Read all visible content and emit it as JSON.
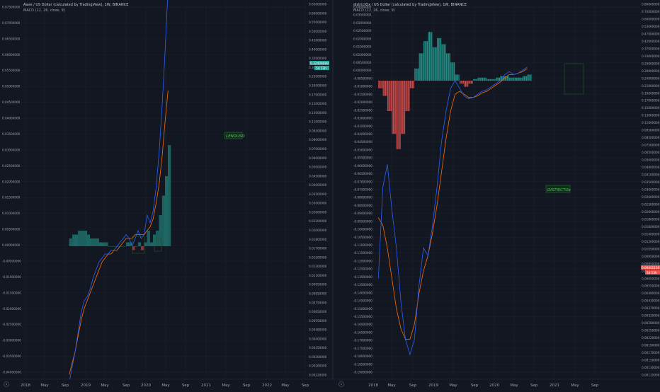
{
  "theme": {
    "bg": "#131722",
    "grid": "#1e222d",
    "macd": "#2962ff",
    "signal": "#ff6d00",
    "hist_pos": "#26a69a",
    "hist_neg": "#ef5350",
    "box": "#1b5e20"
  },
  "left_panel": {
    "header": "Aave / US Dollar (calculated by TradingView), 1W, BINANCE",
    "subheader": "MACD (12, 26, close, 9)",
    "annotation": "LENDUSD",
    "price_badge": "0.32409099",
    "price_badge2": "5d 13h"
  },
  "right_panel": {
    "header": "districtOx / US Dollar (calculated by TradingView), 1W, BINANCE",
    "subheader": "MACD (12, 26, close, 9)",
    "annotation": "DISTRICTOx",
    "price_badge": "0.08451150",
    "price_badge2": "5d 13h"
  },
  "chart_data": [
    {
      "type": "line",
      "title": "Aave / US Dollar (calculated by TradingView), 1W, BINANCE",
      "indicator": "MACD (12, 26, close, 9)",
      "x_ticks": [
        "2018",
        "May",
        "Sep",
        "2019",
        "May",
        "Sep",
        "2020",
        "May",
        "Sep",
        "2021",
        "May",
        "Sep",
        "2022",
        "May",
        "Sep"
      ],
      "macd_axis_ticks": [
        "0.07500000",
        "0.07000000",
        "0.06500000",
        "0.06000000",
        "0.05500000",
        "0.05000000",
        "0.04500000",
        "0.04000000",
        "0.03500000",
        "0.03000000",
        "0.02500000",
        "0.02000000",
        "0.01500000",
        "0.01000000",
        "0.00500000",
        "0.00000000",
        "-0.00500000",
        "-0.01000000",
        "-0.01500000",
        "-0.02000000",
        "-0.02500000",
        "-0.03000000",
        "-0.03500000",
        "-0.04000000"
      ],
      "macd_ylim": [
        -0.0425,
        0.0775
      ],
      "price_axis_ticks": [
        "0.65000000",
        "0.60000000",
        "0.55000000",
        "0.50000000",
        "0.45000000",
        "0.40000000",
        "0.35000000",
        "0.30000000",
        "0.25000000",
        "0.20000000",
        "0.17000000",
        "0.15000000",
        "0.13000000",
        "0.11000000",
        "0.09500000",
        "0.08000000",
        "0.07000000",
        "0.06000000",
        "0.05000000",
        "0.04500000",
        "0.04000000",
        "0.03500000",
        "0.03000000",
        "0.02600000",
        "0.02200000",
        "0.02000000",
        "0.01800000",
        "0.01700000",
        "0.01500000",
        "0.01300000",
        "0.01100000",
        "0.00950000",
        "0.00850000",
        "0.00750000",
        "0.00650000",
        "0.00550000",
        "0.00480000",
        "0.00400000",
        "0.00350000",
        "0.00300000",
        "0.00260000",
        "0.00220000"
      ],
      "x": [
        0.8,
        0.85,
        0.9,
        0.95,
        1.0,
        1.05,
        1.1,
        1.15,
        1.2,
        1.25,
        1.3,
        1.35,
        1.4,
        1.45,
        1.5,
        1.55,
        1.6,
        1.65,
        1.7,
        1.75,
        1.8,
        1.85,
        1.9,
        1.95,
        2.0,
        2.05,
        2.1,
        2.15,
        2.2,
        2.25,
        2.3,
        2.35,
        2.4,
        2.45,
        2.5,
        2.55,
        2.6
      ],
      "series": [
        {
          "name": "MACD",
          "values": [
            -0.035,
            -0.031,
            -0.027,
            -0.022,
            -0.017,
            -0.014,
            -0.013,
            -0.011,
            -0.008,
            -0.006,
            -0.004,
            -0.003,
            -0.002,
            -0.002,
            -0.001,
            -0.001,
            0.0,
            0.001,
            0.002,
            0.003,
            0.002,
            0.0,
            0.002,
            0.004,
            0.002,
            0.003,
            0.008,
            0.006,
            0.009,
            0.015,
            0.024,
            0.036,
            0.05,
            0.066
          ]
        },
        {
          "name": "Signal",
          "values": [
            -0.033,
            -0.03,
            -0.027,
            -0.023,
            -0.019,
            -0.016,
            -0.014,
            -0.012,
            -0.01,
            -0.008,
            -0.006,
            -0.004,
            -0.003,
            -0.002,
            -0.002,
            -0.001,
            -0.001,
            0.0,
            0.001,
            0.002,
            0.002,
            0.002,
            0.003,
            0.003,
            0.003,
            0.003,
            0.004,
            0.005,
            0.007,
            0.011,
            0.016,
            0.023,
            0.032,
            0.04
          ]
        },
        {
          "name": "Histogram",
          "values": [
            0.002,
            0.003,
            0.003,
            0.004,
            0.004,
            0.004,
            0.003,
            0.002,
            0.002,
            0.002,
            0.001,
            0.001,
            0.001,
            0.0,
            0.0,
            0.0,
            0.0,
            0.0,
            0.0,
            0.001,
            0.001,
            -0.001,
            0.0,
            0.001,
            -0.001,
            0.001,
            0.004,
            0.001,
            0.003,
            0.004,
            0.008,
            0.013,
            0.018,
            0.026
          ]
        }
      ]
    },
    {
      "type": "line",
      "title": "districtOx / US Dollar (calculated by TradingView), 1W, BINANCE",
      "indicator": "MACD (12, 26, close, 9)",
      "x_ticks": [
        "2018",
        "May",
        "Sep",
        "2019",
        "May",
        "Sep",
        "2020",
        "May",
        "Sep",
        "2021",
        "May",
        "Sep"
      ],
      "macd_axis_ticks": [
        "0.04000000",
        "0.03500000",
        "0.03000000",
        "0.02500000",
        "0.02000000",
        "0.01500000",
        "0.01000000",
        "0.00500000",
        "0.00000000",
        "-0.00500000",
        "-0.01000000",
        "-0.01500000",
        "-0.02000000",
        "-0.02500000",
        "-0.03000000",
        "-0.03500000",
        "-0.04000000",
        "-0.04500000",
        "-0.05000000",
        "-0.05500000",
        "-0.06000000",
        "-0.06500000",
        "-0.07000000",
        "-0.07500000",
        "-0.08000000",
        "-0.08500000",
        "-0.09000000",
        "-0.09500000",
        "-0.10000000",
        "-0.10500000",
        "-0.11000000",
        "-0.11500000",
        "-0.12000000",
        "-0.12500000",
        "-0.13000000",
        "-0.13500000",
        "-0.14000000",
        "-0.14500000",
        "-0.15000000",
        "-0.15500000",
        "-0.16000000",
        "-0.16500000",
        "-0.17000000",
        "-0.17500000",
        "-0.18000000",
        "-0.18500000",
        "-0.19000000"
      ],
      "macd_ylim": [
        -0.1925,
        0.0425
      ],
      "price_axis_ticks": [
        "0.80000000",
        "0.70000000",
        "0.60000000",
        "0.53000000",
        "0.47000000",
        "0.42000000",
        "0.37000000",
        "0.33000000",
        "0.29000000",
        "0.26000000",
        "0.24000000",
        "0.21000000",
        "0.19000000",
        "0.17000000",
        "0.15000000",
        "0.13000000",
        "0.11000000",
        "0.09500000",
        "0.08500000",
        "0.07500000",
        "0.06500000",
        "0.05600000",
        "0.04800000",
        "0.04100000",
        "0.03500000",
        "0.03000000",
        "0.02600000",
        "0.02300000",
        "0.02000000",
        "0.01800000",
        "0.01600000",
        "0.01400000",
        "0.01200000",
        "0.01050000",
        "0.00950000",
        "0.00850000",
        "0.00750000",
        "0.00650000",
        "0.00550000",
        "0.00490000",
        "0.00430000",
        "0.00370000",
        "0.00320000",
        "0.00280000",
        "0.00250000",
        "0.00220000",
        "0.00190000",
        "0.00170000",
        "0.00150000",
        "0.00130000",
        "0.00115000"
      ],
      "x": [
        0.3,
        0.35,
        0.4,
        0.45,
        0.5,
        0.55,
        0.6,
        0.65,
        0.7,
        0.75,
        0.8,
        0.85,
        0.9,
        0.95,
        1.0,
        1.05,
        1.1,
        1.15,
        1.2,
        1.25,
        1.3,
        1.35,
        1.4,
        1.45,
        1.5,
        1.55,
        1.6,
        1.65,
        1.7,
        1.75,
        1.8,
        1.85,
        1.9,
        1.95,
        2.0,
        2.05,
        2.1,
        2.15,
        2.2
      ],
      "series": [
        {
          "name": "MACD",
          "values": [
            -0.13,
            -0.07,
            -0.055,
            -0.085,
            -0.11,
            -0.145,
            -0.17,
            -0.18,
            -0.17,
            -0.135,
            -0.11,
            -0.115,
            -0.095,
            -0.07,
            -0.04,
            -0.02,
            -0.005,
            0.0,
            -0.005,
            -0.01,
            -0.012,
            -0.011,
            -0.009,
            -0.007,
            -0.006,
            -0.004,
            -0.002,
            0.0,
            0.004,
            0.006,
            0.004,
            0.005,
            0.007,
            0.009
          ]
        },
        {
          "name": "Signal",
          "values": [
            -0.09,
            -0.095,
            -0.11,
            -0.13,
            -0.15,
            -0.163,
            -0.17,
            -0.17,
            -0.16,
            -0.14,
            -0.125,
            -0.115,
            -0.1,
            -0.082,
            -0.06,
            -0.038,
            -0.02,
            -0.009,
            -0.007,
            -0.009,
            -0.011,
            -0.011,
            -0.01,
            -0.008,
            -0.007,
            -0.005,
            -0.003,
            -0.001,
            0.002,
            0.004,
            0.004,
            0.005,
            0.006,
            0.008
          ]
        },
        {
          "name": "Histogram",
          "values": [
            -0.005,
            -0.01,
            -0.02,
            -0.035,
            -0.045,
            -0.035,
            -0.02,
            -0.005,
            0.008,
            0.018,
            0.026,
            0.032,
            0.022,
            0.028,
            0.024,
            0.018,
            0.012,
            0.004,
            -0.002,
            -0.004,
            -0.002,
            0.001,
            0.002,
            0.002,
            0.001,
            0.001,
            0.002,
            0.003,
            0.003,
            0.002,
            0.002,
            0.002,
            0.003,
            0.004
          ]
        }
      ]
    }
  ]
}
